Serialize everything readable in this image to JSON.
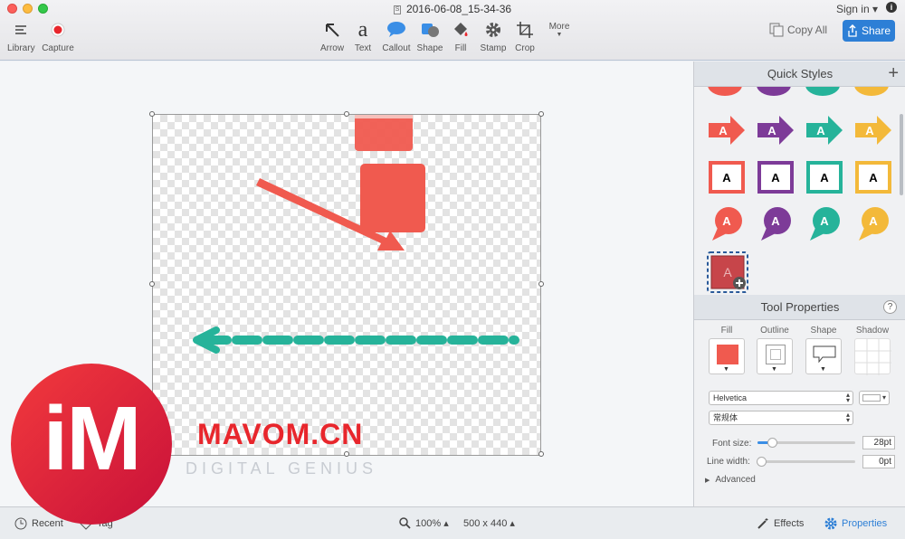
{
  "window": {
    "title": "2016-06-08_15-34-36",
    "file_icon_glyph": "S"
  },
  "toolbar": {
    "library": "Library",
    "capture": "Capture",
    "arrow": "Arrow",
    "text": "Text",
    "text_glyph": "a",
    "callout": "Callout",
    "shape": "Shape",
    "fill": "Fill",
    "stamp": "Stamp",
    "crop": "Crop",
    "more": "More",
    "sign_in": "Sign in ▾",
    "info_glyph": "i",
    "copy_all": "Copy All",
    "share": "Share"
  },
  "quick_styles": {
    "title": "Quick Styles",
    "add_glyph": "+",
    "glyph": "A",
    "colors": [
      "#f05a4f",
      "#7d3b98",
      "#26b39a",
      "#f3b93a"
    ]
  },
  "tool_properties": {
    "title": "Tool Properties",
    "help_glyph": "?",
    "fill_label": "Fill",
    "outline_label": "Outline",
    "shape_label": "Shape",
    "shadow_label": "Shadow",
    "font_name": "Helvetica",
    "font_style": "常规体",
    "font_size_label": "Font size:",
    "font_size_value": "28pt",
    "font_size_level": 0.15,
    "line_width_label": "Line width:",
    "line_width_value": "0pt",
    "line_width_level": 0.0,
    "advanced_label": "Advanced",
    "fill_color": "#f05a4f"
  },
  "statusbar": {
    "recent": "Recent",
    "tag": "Tag",
    "zoom": "100% ▴",
    "dimensions": "500 x 440 ▴",
    "effects": "Effects",
    "properties": "Properties"
  },
  "canvas": {
    "arrow_color": "#f05a4f",
    "dash_color": "#26b39a"
  },
  "watermark": {
    "logo": "iM",
    "brand": "MAVOM.CN",
    "tagline": "DIGITAL GENIUS"
  }
}
